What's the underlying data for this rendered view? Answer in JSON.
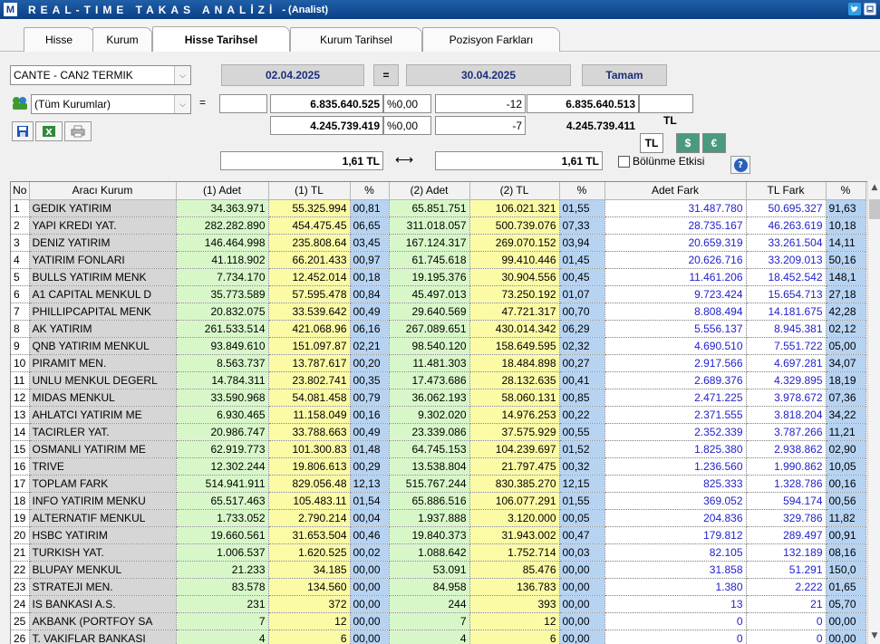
{
  "window": {
    "logo": "M",
    "title": "REAL-TIME TAKAS ANALİZİ",
    "subtitle": "- (Analist)",
    "icons": [
      "twitter-icon",
      "minimize-icon"
    ]
  },
  "tabs": [
    {
      "label": "Hisse",
      "active": false
    },
    {
      "label": "Kurum",
      "active": false
    },
    {
      "label": "Hisse Tarihsel",
      "active": true
    },
    {
      "label": "Kurum Tarihsel",
      "active": false
    },
    {
      "label": "Pozisyon Farkları",
      "active": false
    }
  ],
  "controls": {
    "stock_select": "CANTE - CAN2 TERMIK",
    "date_start": "02.04.2025",
    "equals": "=",
    "date_end": "30.04.2025",
    "ok_label": "Tamam",
    "institution_select": "(Tüm Kurumlar)",
    "eq2": "=",
    "row1": {
      "v1": "",
      "v2": "6.835.640.525",
      "pct": "%0,00",
      "diff": "-12",
      "v3": "6.835.640.513",
      "v4": ""
    },
    "row2": {
      "v2": "4.245.739.419",
      "pct": "%0,00",
      "diff": "-7",
      "v3": "4.245.739.411"
    },
    "currency_label": "TL",
    "currency_tl": "TL",
    "currency_usd": "$",
    "currency_eur": "€",
    "price1": "1,61 TL",
    "arrow": "⟷",
    "price2": "1,61 TL",
    "split_effect_label": "Bölünme Etkisi",
    "help": "?"
  },
  "table": {
    "headers": [
      "No",
      "Aracı Kurum",
      "(1) Adet",
      "(1) TL",
      "%",
      "(2) Adet",
      "(2) TL",
      "%",
      "Adet Fark",
      "TL Fark",
      "%"
    ],
    "rows": [
      [
        "1",
        "GEDIK YATIRIM",
        "34.363.971",
        "55.325.994",
        "00,81",
        "65.851.751",
        "106.021.321",
        "01,55",
        "31.487.780",
        "50.695.327",
        "91,63"
      ],
      [
        "2",
        "YAPI KREDI YAT.",
        "282.282.890",
        "454.475.45",
        "06,65",
        "311.018.057",
        "500.739.076",
        "07,33",
        "28.735.167",
        "46.263.619",
        "10,18"
      ],
      [
        "3",
        "DENIZ YATIRIM",
        "146.464.998",
        "235.808.64",
        "03,45",
        "167.124.317",
        "269.070.152",
        "03,94",
        "20.659.319",
        "33.261.504",
        "14,11"
      ],
      [
        "4",
        "YATIRIM FONLARI",
        "41.118.902",
        "66.201.433",
        "00,97",
        "61.745.618",
        "99.410.446",
        "01,45",
        "20.626.716",
        "33.209.013",
        "50,16"
      ],
      [
        "5",
        "BULLS YATIRIM MENK",
        "7.734.170",
        "12.452.014",
        "00,18",
        "19.195.376",
        "30.904.556",
        "00,45",
        "11.461.206",
        "18.452.542",
        "148,1"
      ],
      [
        "6",
        "A1 CAPITAL MENKUL D",
        "35.773.589",
        "57.595.478",
        "00,84",
        "45.497.013",
        "73.250.192",
        "01,07",
        "9.723.424",
        "15.654.713",
        "27,18"
      ],
      [
        "7",
        "PHILLIPCAPITAL MENK",
        "20.832.075",
        "33.539.642",
        "00,49",
        "29.640.569",
        "47.721.317",
        "00,70",
        "8.808.494",
        "14.181.675",
        "42,28"
      ],
      [
        "8",
        "AK YATIRIM",
        "261.533.514",
        "421.068.96",
        "06,16",
        "267.089.651",
        "430.014.342",
        "06,29",
        "5.556.137",
        "8.945.381",
        "02,12"
      ],
      [
        "9",
        "QNB YATIRIM MENKUL",
        "93.849.610",
        "151.097.87",
        "02,21",
        "98.540.120",
        "158.649.595",
        "02,32",
        "4.690.510",
        "7.551.722",
        "05,00"
      ],
      [
        "10",
        "PIRAMIT MEN.",
        "8.563.737",
        "13.787.617",
        "00,20",
        "11.481.303",
        "18.484.898",
        "00,27",
        "2.917.566",
        "4.697.281",
        "34,07"
      ],
      [
        "11",
        "UNLU MENKUL DEGERL",
        "14.784.311",
        "23.802.741",
        "00,35",
        "17.473.686",
        "28.132.635",
        "00,41",
        "2.689.376",
        "4.329.895",
        "18,19"
      ],
      [
        "12",
        "MIDAS MENKUL",
        "33.590.968",
        "54.081.458",
        "00,79",
        "36.062.193",
        "58.060.131",
        "00,85",
        "2.471.225",
        "3.978.672",
        "07,36"
      ],
      [
        "13",
        "AHLATCI YATIRIM ME",
        "6.930.465",
        "11.158.049",
        "00,16",
        "9.302.020",
        "14.976.253",
        "00,22",
        "2.371.555",
        "3.818.204",
        "34,22"
      ],
      [
        "14",
        "TACIRLER YAT.",
        "20.986.747",
        "33.788.663",
        "00,49",
        "23.339.086",
        "37.575.929",
        "00,55",
        "2.352.339",
        "3.787.266",
        "11,21"
      ],
      [
        "15",
        "OSMANLI YATIRIM ME",
        "62.919.773",
        "101.300.83",
        "01,48",
        "64.745.153",
        "104.239.697",
        "01,52",
        "1.825.380",
        "2.938.862",
        "02,90"
      ],
      [
        "16",
        "TRIVE",
        "12.302.244",
        "19.806.613",
        "00,29",
        "13.538.804",
        "21.797.475",
        "00,32",
        "1.236.560",
        "1.990.862",
        "10,05"
      ],
      [
        "17",
        "TOPLAM FARK",
        "514.941.911",
        "829.056.48",
        "12,13",
        "515.767.244",
        "830.385.270",
        "12,15",
        "825.333",
        "1.328.786",
        "00,16"
      ],
      [
        "18",
        "INFO YATIRIM MENKU",
        "65.517.463",
        "105.483.11",
        "01,54",
        "65.886.516",
        "106.077.291",
        "01,55",
        "369.052",
        "594.174",
        "00,56"
      ],
      [
        "19",
        "ALTERNATIF MENKUL",
        "1.733.052",
        "2.790.214",
        "00,04",
        "1.937.888",
        "3.120.000",
        "00,05",
        "204.836",
        "329.786",
        "11,82"
      ],
      [
        "20",
        "HSBC YATIRIM",
        "19.660.561",
        "31.653.504",
        "00,46",
        "19.840.373",
        "31.943.002",
        "00,47",
        "179.812",
        "289.497",
        "00,91"
      ],
      [
        "21",
        "TURKISH YAT.",
        "1.006.537",
        "1.620.525",
        "00,02",
        "1.088.642",
        "1.752.714",
        "00,03",
        "82.105",
        "132.189",
        "08,16"
      ],
      [
        "22",
        "BLUPAY MENKUL",
        "21.233",
        "34.185",
        "00,00",
        "53.091",
        "85.476",
        "00,00",
        "31.858",
        "51.291",
        "150,0"
      ],
      [
        "23",
        "STRATEJI MEN.",
        "83.578",
        "134.560",
        "00,00",
        "84.958",
        "136.783",
        "00,00",
        "1.380",
        "2.222",
        "01,65"
      ],
      [
        "24",
        "IS BANKASI A.S.",
        "231",
        "372",
        "00,00",
        "244",
        "393",
        "00,00",
        "13",
        "21",
        "05,70"
      ],
      [
        "25",
        "AKBANK (PORTFOY SA",
        "7",
        "12",
        "00,00",
        "7",
        "12",
        "00,00",
        "0",
        "0",
        "00,00"
      ],
      [
        "26",
        "T. VAKIFLAR BANKASI",
        "4",
        "6",
        "00,00",
        "4",
        "6",
        "00,00",
        "0",
        "0",
        "00,00"
      ]
    ]
  },
  "colors": {
    "titlebar": "#0b3f86",
    "name_col": "#d6d6d6",
    "green": "#d8f7c9",
    "yellow": "#fbfba6",
    "blue": "#b7d3f2",
    "diff_text": "#2222cc",
    "currency_active": "#ffffff",
    "currency_inactive": "#4a9a80"
  }
}
